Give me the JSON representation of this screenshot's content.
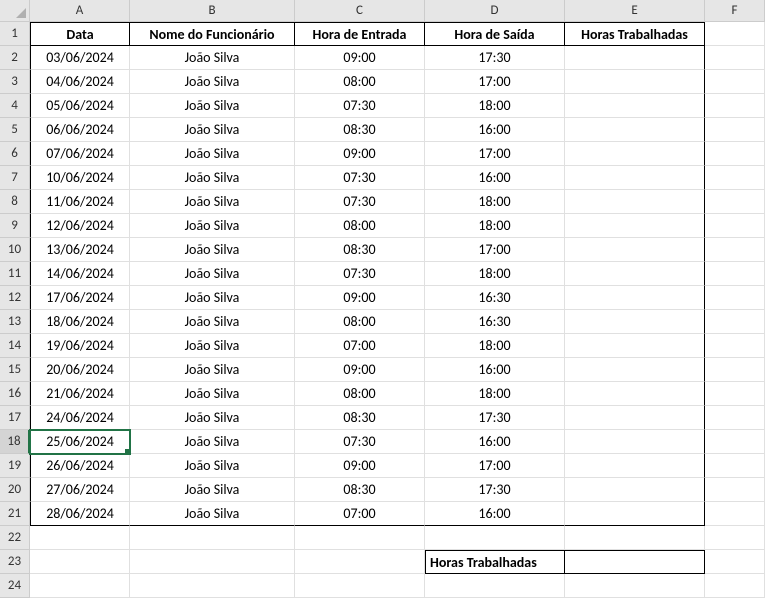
{
  "columns": [
    "A",
    "B",
    "C",
    "D",
    "E",
    "F"
  ],
  "headers": {
    "A": "Data",
    "B": "Nome do Funcionário",
    "C": "Hora de Entrada",
    "D": "Hora de Saída",
    "E": "Horas Trabalhadas"
  },
  "rows": [
    {
      "data": "03/06/2024",
      "nome": "João Silva",
      "entrada": "09:00",
      "saida": "17:30",
      "horas": ""
    },
    {
      "data": "04/06/2024",
      "nome": "João Silva",
      "entrada": "08:00",
      "saida": "17:00",
      "horas": ""
    },
    {
      "data": "05/06/2024",
      "nome": "João Silva",
      "entrada": "07:30",
      "saida": "18:00",
      "horas": ""
    },
    {
      "data": "06/06/2024",
      "nome": "João Silva",
      "entrada": "08:30",
      "saida": "16:00",
      "horas": ""
    },
    {
      "data": "07/06/2024",
      "nome": "João Silva",
      "entrada": "09:00",
      "saida": "17:00",
      "horas": ""
    },
    {
      "data": "10/06/2024",
      "nome": "João Silva",
      "entrada": "07:30",
      "saida": "16:00",
      "horas": ""
    },
    {
      "data": "11/06/2024",
      "nome": "João Silva",
      "entrada": "07:30",
      "saida": "18:00",
      "horas": ""
    },
    {
      "data": "12/06/2024",
      "nome": "João Silva",
      "entrada": "08:00",
      "saida": "18:00",
      "horas": ""
    },
    {
      "data": "13/06/2024",
      "nome": "João Silva",
      "entrada": "08:30",
      "saida": "17:00",
      "horas": ""
    },
    {
      "data": "14/06/2024",
      "nome": "João Silva",
      "entrada": "07:30",
      "saida": "18:00",
      "horas": ""
    },
    {
      "data": "17/06/2024",
      "nome": "João Silva",
      "entrada": "09:00",
      "saida": "16:30",
      "horas": ""
    },
    {
      "data": "18/06/2024",
      "nome": "João Silva",
      "entrada": "08:00",
      "saida": "16:30",
      "horas": ""
    },
    {
      "data": "19/06/2024",
      "nome": "João Silva",
      "entrada": "07:00",
      "saida": "18:00",
      "horas": ""
    },
    {
      "data": "20/06/2024",
      "nome": "João Silva",
      "entrada": "09:00",
      "saida": "16:00",
      "horas": ""
    },
    {
      "data": "21/06/2024",
      "nome": "João Silva",
      "entrada": "08:00",
      "saida": "18:00",
      "horas": ""
    },
    {
      "data": "24/06/2024",
      "nome": "João Silva",
      "entrada": "08:30",
      "saida": "17:30",
      "horas": ""
    },
    {
      "data": "25/06/2024",
      "nome": "João Silva",
      "entrada": "07:30",
      "saida": "16:00",
      "horas": ""
    },
    {
      "data": "26/06/2024",
      "nome": "João Silva",
      "entrada": "09:00",
      "saida": "17:00",
      "horas": ""
    },
    {
      "data": "27/06/2024",
      "nome": "João Silva",
      "entrada": "08:30",
      "saida": "17:30",
      "horas": ""
    },
    {
      "data": "28/06/2024",
      "nome": "João Silva",
      "entrada": "07:00",
      "saida": "16:00",
      "horas": ""
    }
  ],
  "summary": {
    "label": "Horas Trabalhadas",
    "value": ""
  },
  "active_cell_row": 18
}
